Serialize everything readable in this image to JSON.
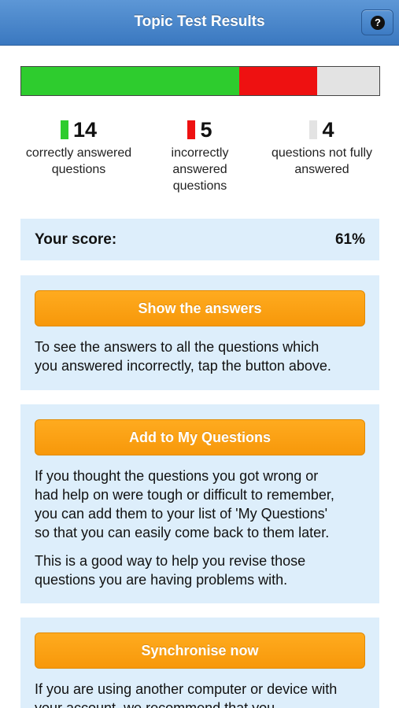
{
  "header": {
    "title": "Topic Test Results",
    "help_icon": "?"
  },
  "results": {
    "correct": 14,
    "incorrect": 5,
    "not_fully_answered": 4,
    "colors": {
      "correct": "#2ecc2e",
      "incorrect": "#ee1111",
      "not_fully_answered": "#e3e3e3"
    }
  },
  "stats": [
    {
      "number": "14",
      "label_line1": "correctly answered",
      "label_line2": "questions",
      "label_line3": ""
    },
    {
      "number": "5",
      "label_line1": "incorrectly",
      "label_line2": "answered",
      "label_line3": "questions"
    },
    {
      "number": "4",
      "label_line1": "questions not fully",
      "label_line2": "answered",
      "label_line3": ""
    }
  ],
  "score": {
    "label": "Your score:",
    "value": "61%"
  },
  "panels": {
    "show_answers": {
      "button": "Show the answers",
      "text_line1": "To see the answers to all the questions which",
      "text_line2": "you answered incorrectly, tap the button above."
    },
    "my_questions": {
      "button": "Add to My Questions",
      "para1_line1": "If you thought the questions you got wrong or",
      "para1_line2": "had help on were tough or difficult to remember,",
      "para1_line3": "you can add them to your list of 'My Questions'",
      "para1_line4": "so that you can easily come back to them later.",
      "para2_line1": "This is a good way to help you revise those",
      "para2_line2": "questions you are having problems with."
    },
    "synchronise": {
      "button": "Synchronise now",
      "text_line1": "If you are using another computer or device with",
      "text_line2": "your account, we recommend that you"
    }
  }
}
